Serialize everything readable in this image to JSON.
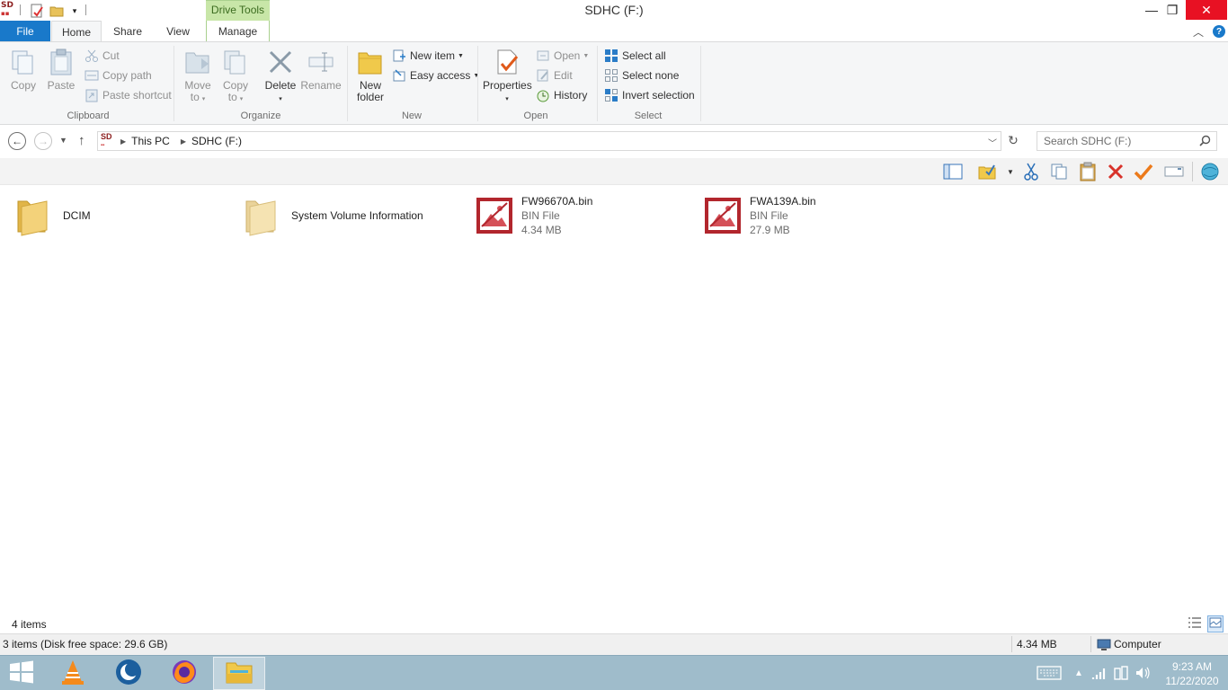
{
  "window": {
    "title": "SDHC (F:)",
    "context_tab_group": "Drive Tools",
    "app_icon_text": "SD",
    "minimize": "—",
    "maximize": "❐",
    "close": "✕"
  },
  "tabs": {
    "file": "File",
    "home": "Home",
    "share": "Share",
    "view": "View",
    "manage": "Manage"
  },
  "ribbon": {
    "clipboard": {
      "label": "Clipboard",
      "copy": "Copy",
      "paste": "Paste",
      "cut": "Cut",
      "copy_path": "Copy path",
      "paste_shortcut": "Paste shortcut"
    },
    "organize": {
      "label": "Organize",
      "move_to": "Move to",
      "copy_to": "Copy to",
      "delete": "Delete",
      "rename": "Rename"
    },
    "new": {
      "label": "New",
      "new_folder": "New folder",
      "new_item": "New item",
      "easy_access": "Easy access"
    },
    "open": {
      "label": "Open",
      "properties": "Properties",
      "open": "Open",
      "edit": "Edit",
      "history": "History"
    },
    "select": {
      "label": "Select",
      "select_all": "Select all",
      "select_none": "Select none",
      "invert_selection": "Invert selection"
    }
  },
  "address": {
    "breadcrumbs": [
      "This PC",
      "SDHC (F:)"
    ],
    "search_placeholder": "Search SDHC (F:)"
  },
  "items": [
    {
      "name": "DCIM",
      "type": "folder",
      "subtitle": "",
      "size": ""
    },
    {
      "name": "System Volume Information",
      "type": "folder",
      "subtitle": "",
      "size": ""
    },
    {
      "name": "FW96670A.bin",
      "type": "bin",
      "subtitle": "BIN File",
      "size": "4.34 MB"
    },
    {
      "name": "FWA139A.bin",
      "type": "bin",
      "subtitle": "BIN File",
      "size": "27.9 MB"
    }
  ],
  "status": {
    "item_count": "4 items",
    "selection": "3 items (Disk free space: 29.6 GB)",
    "size": "4.34 MB",
    "location": "Computer"
  },
  "taskbar": {
    "time": "9:23 AM",
    "date": "11/22/2020"
  },
  "colors": {
    "accent": "#1979ca",
    "drive_tools": "#c8e6a8",
    "close_red": "#e81123",
    "taskbar": "#9fbccb",
    "folder": "#e8c25a"
  }
}
